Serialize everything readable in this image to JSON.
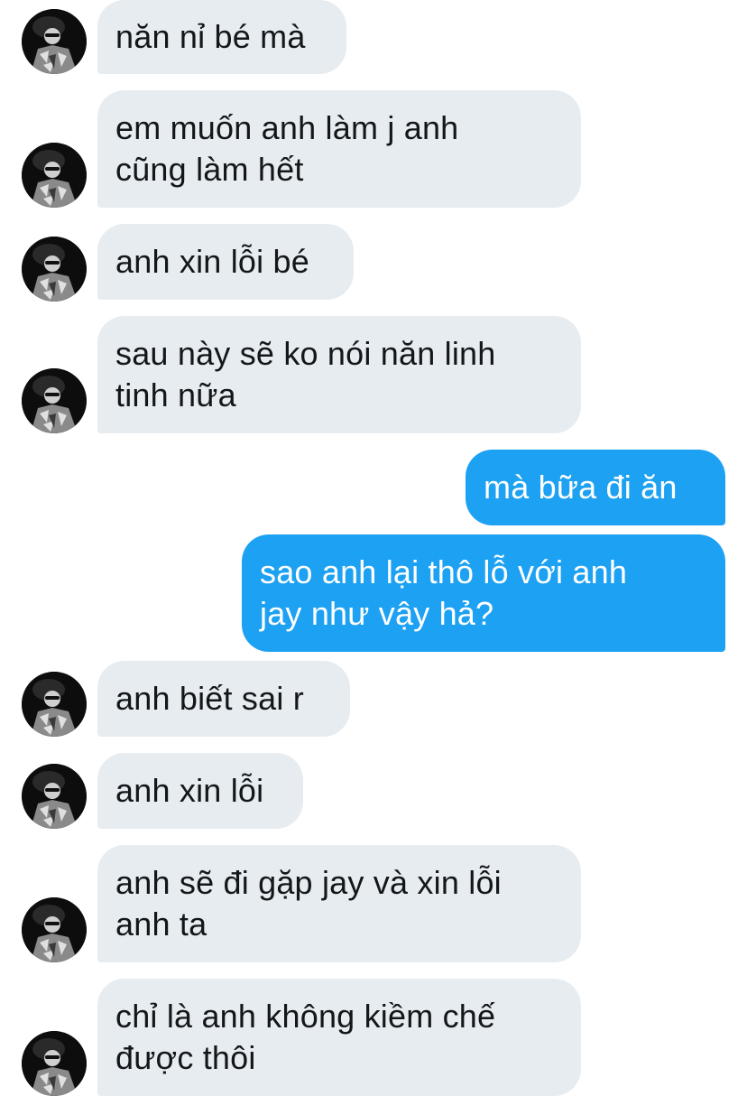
{
  "conversation": {
    "messages": [
      {
        "sender": "them",
        "text": "năn nỉ bé mà"
      },
      {
        "sender": "them",
        "text": "em muốn anh làm j anh\ncũng làm hết"
      },
      {
        "sender": "them",
        "text": "anh xin lỗi bé"
      },
      {
        "sender": "them",
        "text": "sau này sẽ ko nói năn linh\ntinh nữa"
      },
      {
        "sender": "me",
        "text": "mà bữa đi ăn"
      },
      {
        "sender": "me",
        "text": "sao anh lại thô lỗ với anh\njay như vậy hả?"
      },
      {
        "sender": "them",
        "text": "anh biết sai r"
      },
      {
        "sender": "them",
        "text": "anh xin lỗi"
      },
      {
        "sender": "them",
        "text": "anh sẽ đi gặp jay và xin lỗi\nanh ta"
      },
      {
        "sender": "them",
        "text": "chỉ là anh không kiềm chế\nđược thôi"
      }
    ]
  },
  "colors": {
    "incoming_bubble": "#e6ecf0",
    "outgoing_bubble": "#1da1f2",
    "incoming_text": "#14171a",
    "outgoing_text": "#ffffff"
  }
}
